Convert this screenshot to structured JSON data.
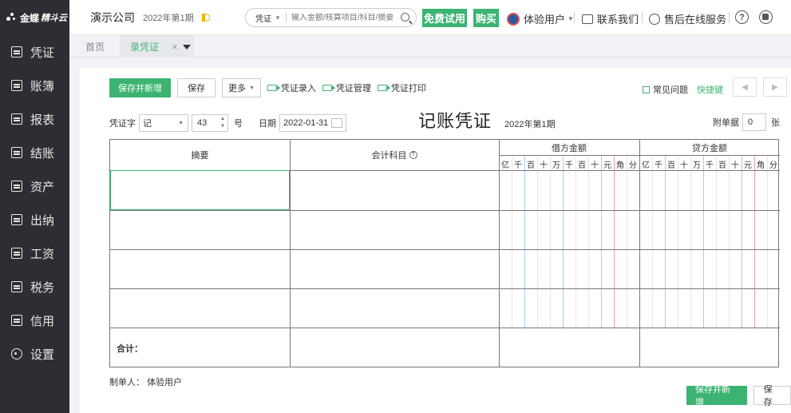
{
  "sidebar": {
    "logo": "金蝶",
    "logo_accent": "精斗云",
    "items": [
      {
        "label": "凭证",
        "icon": "voucher-icon"
      },
      {
        "label": "账簿",
        "icon": "ledger-icon"
      },
      {
        "label": "报表",
        "icon": "report-icon"
      },
      {
        "label": "结账",
        "icon": "close-account-icon"
      },
      {
        "label": "资产",
        "icon": "asset-icon"
      },
      {
        "label": "出纳",
        "icon": "cashier-icon"
      },
      {
        "label": "工资",
        "icon": "salary-icon"
      },
      {
        "label": "税务",
        "icon": "tax-icon"
      },
      {
        "label": "信用",
        "icon": "credit-icon"
      },
      {
        "label": "设置",
        "icon": "settings-icon"
      }
    ]
  },
  "header": {
    "company": "演示公司",
    "period": "2022年第1期",
    "search_type": "凭证",
    "search_placeholder": "输入金额/核算项目/科目/摘要",
    "trial_label": "免费试用",
    "buy_label": "购买",
    "user_label": "体验用户",
    "contact_label": "联系我们",
    "service_label": "售后在线服务",
    "help_glyph": "?"
  },
  "tabs": {
    "home": "首页",
    "active": "录凭证",
    "close": "×"
  },
  "toolbar": {
    "save_new": "保存并新增",
    "save": "保存",
    "more": "更多",
    "links": [
      "凭证录入",
      "凭证管理",
      "凭证打印"
    ],
    "faq": "常见问题",
    "shortcut": "快捷键",
    "prev": "◀",
    "next": "▶"
  },
  "voucher": {
    "type_label": "凭证字",
    "type_value": "记",
    "number": "43",
    "number_suffix": "号",
    "date_label": "日期",
    "date_value": "2022-01-31",
    "title": "记账凭证",
    "period": "2022年第1期",
    "attach_label": "附单据",
    "attach_value": "0",
    "attach_unit": "张"
  },
  "table": {
    "col_summary": "摘要",
    "col_account": "会计科目",
    "col_account_help": "?",
    "col_debit": "借方金额",
    "col_credit": "贷方金额",
    "digits": [
      "亿",
      "千",
      "百",
      "十",
      "万",
      "千",
      "百",
      "十",
      "元",
      "角",
      "分"
    ],
    "total_label": "合计："
  },
  "footer": {
    "maker_label": "制单人：",
    "maker_value": "体验用户",
    "save_new": "保存并新增",
    "save": "保存"
  },
  "colors": {
    "accent": "#3cb371",
    "sidebar": "#2d2e33"
  }
}
